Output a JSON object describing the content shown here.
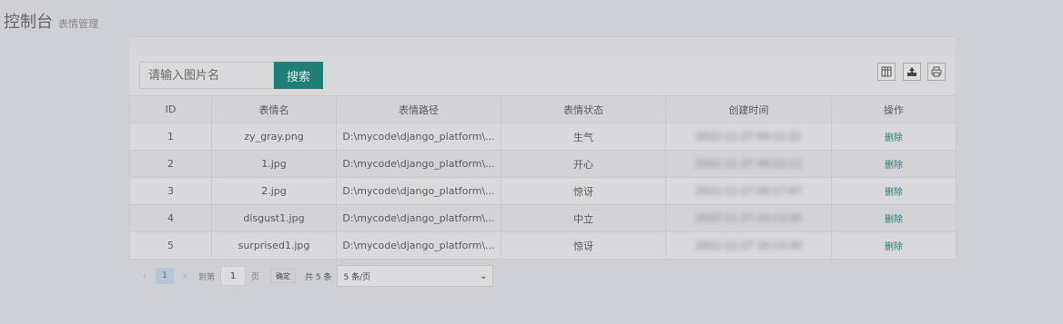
{
  "header": {
    "title": "控制台",
    "subtitle": "表情管理"
  },
  "toolbar": {
    "search_placeholder": "请输入图片名",
    "search_label": "搜索",
    "icons": [
      "columns-icon",
      "export-icon",
      "print-icon"
    ]
  },
  "table": {
    "columns": [
      "ID",
      "表情名",
      "表情路径",
      "表情状态",
      "创建时间",
      "操作"
    ],
    "rows": [
      {
        "id": "1",
        "name": "zy_gray.png",
        "path": "D:\\mycode\\django_platform\\...",
        "status": "生气",
        "created": "2022-11-27 09:11:22",
        "action": "删除"
      },
      {
        "id": "2",
        "name": "1.jpg",
        "path": "D:\\mycode\\django_platform\\...",
        "status": "开心",
        "created": "2022-11-27 09:22:11",
        "action": "删除"
      },
      {
        "id": "3",
        "name": "2.jpg",
        "path": "D:\\mycode\\django_platform\\...",
        "status": "惊讶",
        "created": "2022-11-27 09:17:07",
        "action": "删除"
      },
      {
        "id": "4",
        "name": "disgust1.jpg",
        "path": "D:\\mycode\\django_platform\\...",
        "status": "中立",
        "created": "2022-11-27 10:13:35",
        "action": "删除"
      },
      {
        "id": "5",
        "name": "surprised1.jpg",
        "path": "D:\\mycode\\django_platform\\...",
        "status": "惊讶",
        "created": "2022-11-27 10:13:30",
        "action": "删除"
      }
    ]
  },
  "pager": {
    "prev": "‹",
    "current_page": "1",
    "next": "›",
    "goto_label": "到第",
    "goto_value": "1",
    "page_unit": "页",
    "confirm_label": "确定",
    "total": "共 5 条",
    "page_size": "5 条/页"
  }
}
